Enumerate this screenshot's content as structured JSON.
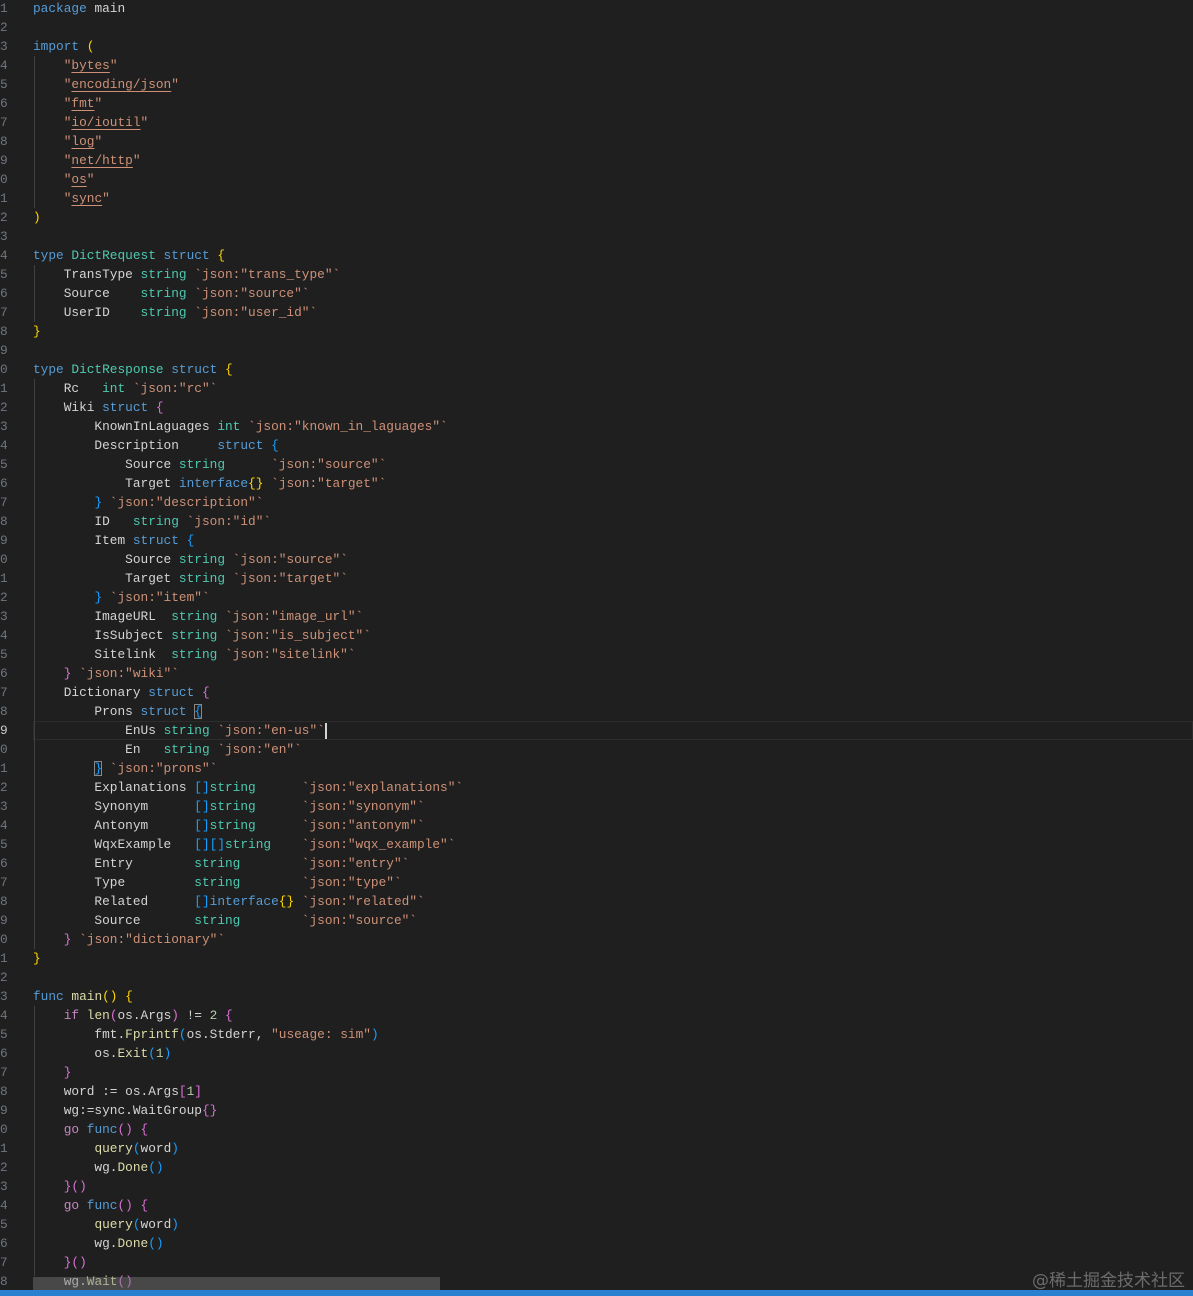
{
  "editor": {
    "language": "go",
    "cursor_line": 39
  },
  "code": {
    "lines": [
      [
        [
          "package",
          "k"
        ],
        [
          " main",
          "p"
        ]
      ],
      [],
      [
        [
          "import",
          "k"
        ],
        [
          " ",
          "p"
        ],
        [
          "(",
          "b1"
        ]
      ],
      [
        [
          "    \"",
          "s"
        ],
        [
          "bytes",
          "u"
        ],
        [
          "\"",
          "s"
        ]
      ],
      [
        [
          "    \"",
          "s"
        ],
        [
          "encoding/json",
          "u"
        ],
        [
          "\"",
          "s"
        ]
      ],
      [
        [
          "    \"",
          "s"
        ],
        [
          "fmt",
          "u"
        ],
        [
          "\"",
          "s"
        ]
      ],
      [
        [
          "    \"",
          "s"
        ],
        [
          "io/ioutil",
          "u"
        ],
        [
          "\"",
          "s"
        ]
      ],
      [
        [
          "    \"",
          "s"
        ],
        [
          "log",
          "u"
        ],
        [
          "\"",
          "s"
        ]
      ],
      [
        [
          "    \"",
          "s"
        ],
        [
          "net/http",
          "u"
        ],
        [
          "\"",
          "s"
        ]
      ],
      [
        [
          "    \"",
          "s"
        ],
        [
          "os",
          "u"
        ],
        [
          "\"",
          "s"
        ]
      ],
      [
        [
          "    \"",
          "s"
        ],
        [
          "sync",
          "u"
        ],
        [
          "\"",
          "s"
        ]
      ],
      [
        [
          ")",
          "b1"
        ]
      ],
      [],
      [
        [
          "type",
          "k"
        ],
        [
          " DictRequest",
          "t"
        ],
        [
          " struct",
          "k"
        ],
        [
          " ",
          "p"
        ],
        [
          "{",
          "b1"
        ]
      ],
      [
        [
          "    TransType ",
          "p"
        ],
        [
          "string",
          "t"
        ],
        [
          " `json:\"trans_type\"`",
          "s"
        ]
      ],
      [
        [
          "    Source    ",
          "p"
        ],
        [
          "string",
          "t"
        ],
        [
          " `json:\"source\"`",
          "s"
        ]
      ],
      [
        [
          "    UserID    ",
          "p"
        ],
        [
          "string",
          "t"
        ],
        [
          " `json:\"user_id\"`",
          "s"
        ]
      ],
      [
        [
          "}",
          "b1"
        ]
      ],
      [],
      [
        [
          "type",
          "k"
        ],
        [
          " DictResponse",
          "t"
        ],
        [
          " struct",
          "k"
        ],
        [
          " ",
          "p"
        ],
        [
          "{",
          "b1"
        ]
      ],
      [
        [
          "    Rc   ",
          "p"
        ],
        [
          "int",
          "t"
        ],
        [
          " `json:\"rc\"`",
          "s"
        ]
      ],
      [
        [
          "    Wiki ",
          "p"
        ],
        [
          "struct",
          "k"
        ],
        [
          " ",
          "p"
        ],
        [
          "{",
          "b2"
        ]
      ],
      [
        [
          "        KnownInLaguages ",
          "p"
        ],
        [
          "int",
          "t"
        ],
        [
          " `json:\"known_in_laguages\"`",
          "s"
        ]
      ],
      [
        [
          "        Description     ",
          "p"
        ],
        [
          "struct",
          "k"
        ],
        [
          " ",
          "p"
        ],
        [
          "{",
          "b3"
        ]
      ],
      [
        [
          "            Source ",
          "p"
        ],
        [
          "string",
          "t"
        ],
        [
          "      `json:\"source\"`",
          "s"
        ]
      ],
      [
        [
          "            Target ",
          "p"
        ],
        [
          "interface",
          "k"
        ],
        [
          "{}",
          "b1"
        ],
        [
          " `json:\"target\"`",
          "s"
        ]
      ],
      [
        [
          "        ",
          "p"
        ],
        [
          "}",
          "b3"
        ],
        [
          " `json:\"description\"`",
          "s"
        ]
      ],
      [
        [
          "        ID   ",
          "p"
        ],
        [
          "string",
          "t"
        ],
        [
          " `json:\"id\"`",
          "s"
        ]
      ],
      [
        [
          "        Item ",
          "p"
        ],
        [
          "struct",
          "k"
        ],
        [
          " ",
          "p"
        ],
        [
          "{",
          "b3"
        ]
      ],
      [
        [
          "            Source ",
          "p"
        ],
        [
          "string",
          "t"
        ],
        [
          " `json:\"source\"`",
          "s"
        ]
      ],
      [
        [
          "            Target ",
          "p"
        ],
        [
          "string",
          "t"
        ],
        [
          " `json:\"target\"`",
          "s"
        ]
      ],
      [
        [
          "        ",
          "p"
        ],
        [
          "}",
          "b3"
        ],
        [
          " `json:\"item\"`",
          "s"
        ]
      ],
      [
        [
          "        ImageURL  ",
          "p"
        ],
        [
          "string",
          "t"
        ],
        [
          " `json:\"image_url\"`",
          "s"
        ]
      ],
      [
        [
          "        IsSubject ",
          "p"
        ],
        [
          "string",
          "t"
        ],
        [
          " `json:\"is_subject\"`",
          "s"
        ]
      ],
      [
        [
          "        Sitelink  ",
          "p"
        ],
        [
          "string",
          "t"
        ],
        [
          " `json:\"sitelink\"`",
          "s"
        ]
      ],
      [
        [
          "    ",
          "p"
        ],
        [
          "}",
          "b2"
        ],
        [
          " `json:\"wiki\"`",
          "s"
        ]
      ],
      [
        [
          "    Dictionary ",
          "p"
        ],
        [
          "struct",
          "k"
        ],
        [
          " ",
          "p"
        ],
        [
          "{",
          "b2"
        ]
      ],
      [
        [
          "        Prons ",
          "p"
        ],
        [
          "struct",
          "k"
        ],
        [
          " ",
          "p"
        ],
        [
          "{",
          "b3 m"
        ]
      ],
      [
        [
          "            EnUs ",
          "p"
        ],
        [
          "string",
          "t"
        ],
        [
          " `json:\"en-us\"`",
          "s"
        ]
      ],
      [
        [
          "            En   ",
          "p"
        ],
        [
          "string",
          "t"
        ],
        [
          " `json:\"en\"`",
          "s"
        ]
      ],
      [
        [
          "        ",
          "p"
        ],
        [
          "}",
          "b3 m"
        ],
        [
          " `json:\"prons\"`",
          "s"
        ]
      ],
      [
        [
          "        Explanations ",
          "p"
        ],
        [
          "[]",
          "b3"
        ],
        [
          "string",
          "t"
        ],
        [
          "      `json:\"explanations\"`",
          "s"
        ]
      ],
      [
        [
          "        Synonym      ",
          "p"
        ],
        [
          "[]",
          "b3"
        ],
        [
          "string",
          "t"
        ],
        [
          "      `json:\"synonym\"`",
          "s"
        ]
      ],
      [
        [
          "        Antonym      ",
          "p"
        ],
        [
          "[]",
          "b3"
        ],
        [
          "string",
          "t"
        ],
        [
          "      `json:\"antonym\"`",
          "s"
        ]
      ],
      [
        [
          "        WqxExample   ",
          "p"
        ],
        [
          "[][]",
          "b3"
        ],
        [
          "string",
          "t"
        ],
        [
          "    `json:\"wqx_example\"`",
          "s"
        ]
      ],
      [
        [
          "        Entry        ",
          "p"
        ],
        [
          "string",
          "t"
        ],
        [
          "        `json:\"entry\"`",
          "s"
        ]
      ],
      [
        [
          "        Type         ",
          "p"
        ],
        [
          "string",
          "t"
        ],
        [
          "        `json:\"type\"`",
          "s"
        ]
      ],
      [
        [
          "        Related      ",
          "p"
        ],
        [
          "[]",
          "b3"
        ],
        [
          "interface",
          "k"
        ],
        [
          "{}",
          "b1"
        ],
        [
          " `json:\"related\"`",
          "s"
        ]
      ],
      [
        [
          "        Source       ",
          "p"
        ],
        [
          "string",
          "t"
        ],
        [
          "        `json:\"source\"`",
          "s"
        ]
      ],
      [
        [
          "    ",
          "p"
        ],
        [
          "}",
          "b2"
        ],
        [
          " `json:\"dictionary\"`",
          "s"
        ]
      ],
      [
        [
          "}",
          "b1"
        ]
      ],
      [],
      [
        [
          "func",
          "k"
        ],
        [
          " ",
          "p"
        ],
        [
          "main",
          "f"
        ],
        [
          "()",
          "b1"
        ],
        [
          " ",
          "p"
        ],
        [
          "{",
          "b1"
        ]
      ],
      [
        [
          "    ",
          "p"
        ],
        [
          "if",
          "kc"
        ],
        [
          " ",
          "p"
        ],
        [
          "len",
          "f"
        ],
        [
          "(",
          "b2"
        ],
        [
          "os.Args",
          "p"
        ],
        [
          ")",
          "b2"
        ],
        [
          " != ",
          "p"
        ],
        [
          "2",
          "n"
        ],
        [
          " ",
          "p"
        ],
        [
          "{",
          "b2"
        ]
      ],
      [
        [
          "        fmt.",
          "p"
        ],
        [
          "Fprintf",
          "f"
        ],
        [
          "(",
          "b3"
        ],
        [
          "os.Stderr, ",
          "p"
        ],
        [
          "\"useage: sim\"",
          "s"
        ],
        [
          ")",
          "b3"
        ]
      ],
      [
        [
          "        os.",
          "p"
        ],
        [
          "Exit",
          "f"
        ],
        [
          "(",
          "b3"
        ],
        [
          "1",
          "n"
        ],
        [
          ")",
          "b3"
        ]
      ],
      [
        [
          "    ",
          "p"
        ],
        [
          "}",
          "b2"
        ]
      ],
      [
        [
          "    word := os.Args",
          "p"
        ],
        [
          "[",
          "b2"
        ],
        [
          "1",
          "n"
        ],
        [
          "]",
          "b2"
        ]
      ],
      [
        [
          "    wg:=sync.WaitGroup",
          "p"
        ],
        [
          "{}",
          "b2"
        ]
      ],
      [
        [
          "    ",
          "p"
        ],
        [
          "go",
          "kc"
        ],
        [
          " ",
          "p"
        ],
        [
          "func",
          "k"
        ],
        [
          "()",
          "b2"
        ],
        [
          " ",
          "p"
        ],
        [
          "{",
          "b2"
        ]
      ],
      [
        [
          "        ",
          "p"
        ],
        [
          "query",
          "f"
        ],
        [
          "(",
          "b3"
        ],
        [
          "word",
          "p"
        ],
        [
          ")",
          "b3"
        ]
      ],
      [
        [
          "        wg.",
          "p"
        ],
        [
          "Done",
          "f"
        ],
        [
          "()",
          "b3"
        ]
      ],
      [
        [
          "    ",
          "p"
        ],
        [
          "}()",
          "b2"
        ]
      ],
      [
        [
          "    ",
          "p"
        ],
        [
          "go",
          "kc"
        ],
        [
          " ",
          "p"
        ],
        [
          "func",
          "k"
        ],
        [
          "()",
          "b2"
        ],
        [
          " ",
          "p"
        ],
        [
          "{",
          "b2"
        ]
      ],
      [
        [
          "        ",
          "p"
        ],
        [
          "query",
          "f"
        ],
        [
          "(",
          "b3"
        ],
        [
          "word",
          "p"
        ],
        [
          ")",
          "b3"
        ]
      ],
      [
        [
          "        wg.",
          "p"
        ],
        [
          "Done",
          "f"
        ],
        [
          "()",
          "b3"
        ]
      ],
      [
        [
          "    ",
          "p"
        ],
        [
          "}()",
          "b2"
        ]
      ],
      [
        [
          "    wg.",
          "p"
        ],
        [
          "Wait",
          "f"
        ],
        [
          "()",
          "b2"
        ]
      ]
    ],
    "line_numbers": [
      "1",
      "2",
      "3",
      "4",
      "5",
      "6",
      "7",
      "8",
      "9",
      "0",
      "1",
      "2",
      "3",
      "4",
      "5",
      "6",
      "7",
      "8",
      "9",
      "0",
      "1",
      "2",
      "3",
      "4",
      "5",
      "6",
      "7",
      "8",
      "9",
      "0",
      "1",
      "2",
      "3",
      "4",
      "5",
      "6",
      "7",
      "8",
      "9",
      "0",
      "1",
      "2",
      "3",
      "4",
      "5",
      "6",
      "7",
      "8",
      "9",
      "0",
      "1",
      "2",
      "3",
      "4",
      "5",
      "6",
      "7",
      "8",
      "9",
      "0",
      "1",
      "2",
      "3",
      "4",
      "5",
      "6",
      "7",
      "8"
    ]
  },
  "watermark": "@稀土掘金技术社区",
  "colors": {
    "background": "#1f1f1f",
    "keyword": "#569cd6",
    "type": "#4ec9b0",
    "string": "#ce9178",
    "function": "#dcdcaa",
    "statusbar": "#2b7fd0"
  }
}
